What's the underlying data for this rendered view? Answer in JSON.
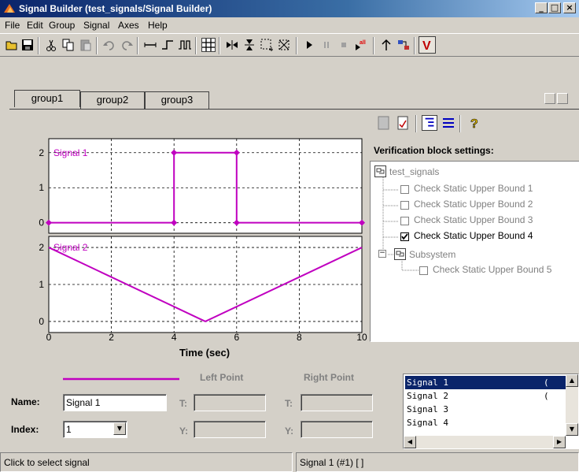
{
  "window": {
    "title": "Signal Builder (test_signals/Signal Builder)",
    "controls": [
      "_",
      "□",
      "×"
    ]
  },
  "menu": [
    "File",
    "Edit",
    "Group",
    "Signal",
    "Axes",
    "Help"
  ],
  "toolbar_icons": [
    "open-icon",
    "save-icon",
    "cut-icon",
    "copy-icon",
    "paste-icon",
    "undo-icon",
    "redo-icon",
    "constant-icon",
    "step-icon",
    "pulse-icon",
    "grid-icon",
    "zoom-x-icon",
    "zoom-y-icon",
    "zoom-box-icon",
    "full-view-icon",
    "play-icon",
    "pause-icon",
    "stop-icon",
    "play-all-icon",
    "up-icon",
    "simulink-icon",
    "verification-icon"
  ],
  "tabs": [
    {
      "label": "group1",
      "active": true
    },
    {
      "label": "group2",
      "active": false
    },
    {
      "label": "group3",
      "active": false
    }
  ],
  "plots": {
    "signal1": {
      "name": "Signal 1",
      "x": [
        0,
        4,
        4,
        6,
        6,
        10
      ],
      "y": [
        0,
        0,
        2,
        2,
        0,
        0
      ],
      "ylim": [
        -0.3,
        2.4
      ],
      "yticks": [
        "0",
        "1",
        "2"
      ],
      "color": "#c000c0"
    },
    "signal2": {
      "name": "Signal 2",
      "x": [
        0,
        5,
        10
      ],
      "y": [
        2,
        0,
        2
      ],
      "ylim": [
        -0.3,
        2.3
      ],
      "yticks": [
        "0",
        "1",
        "2"
      ],
      "color": "#c000c0"
    },
    "xticks": [
      "0",
      "2",
      "4",
      "6",
      "8",
      "10"
    ],
    "xlabel": "Time (sec)"
  },
  "verification": {
    "label": "Verification block settings:",
    "tree": [
      {
        "label": "test_signals",
        "level": 0,
        "type": "model"
      },
      {
        "label": "Check Static Upper Bound 1",
        "level": 1,
        "checked": false
      },
      {
        "label": "Check Static Upper Bound 2",
        "level": 1,
        "checked": false
      },
      {
        "label": "Check Static Upper Bound 3",
        "level": 1,
        "checked": false
      },
      {
        "label": "Check Static Upper Bound 4",
        "level": 1,
        "checked": true
      },
      {
        "label": "Subsystem",
        "level": 1,
        "type": "subsystem"
      },
      {
        "label": "Check Static Upper Bound 5",
        "level": 2,
        "checked": false
      }
    ]
  },
  "editor": {
    "left_point_label": "Left Point",
    "right_point_label": "Right Point",
    "name_label": "Name:",
    "name_value": "Signal 1",
    "index_label": "Index:",
    "index_value": "1",
    "t_label": "T:",
    "y_label": "Y:"
  },
  "signal_list": {
    "rows": [
      "Signal 1",
      "Signal 2",
      "Signal 3",
      "Signal 4"
    ],
    "selected": 0,
    "row_suffixes": [
      "(",
      "("
    ]
  },
  "status": {
    "left": "Click to select signal",
    "right": "Signal 1 (#1) [ ]"
  }
}
